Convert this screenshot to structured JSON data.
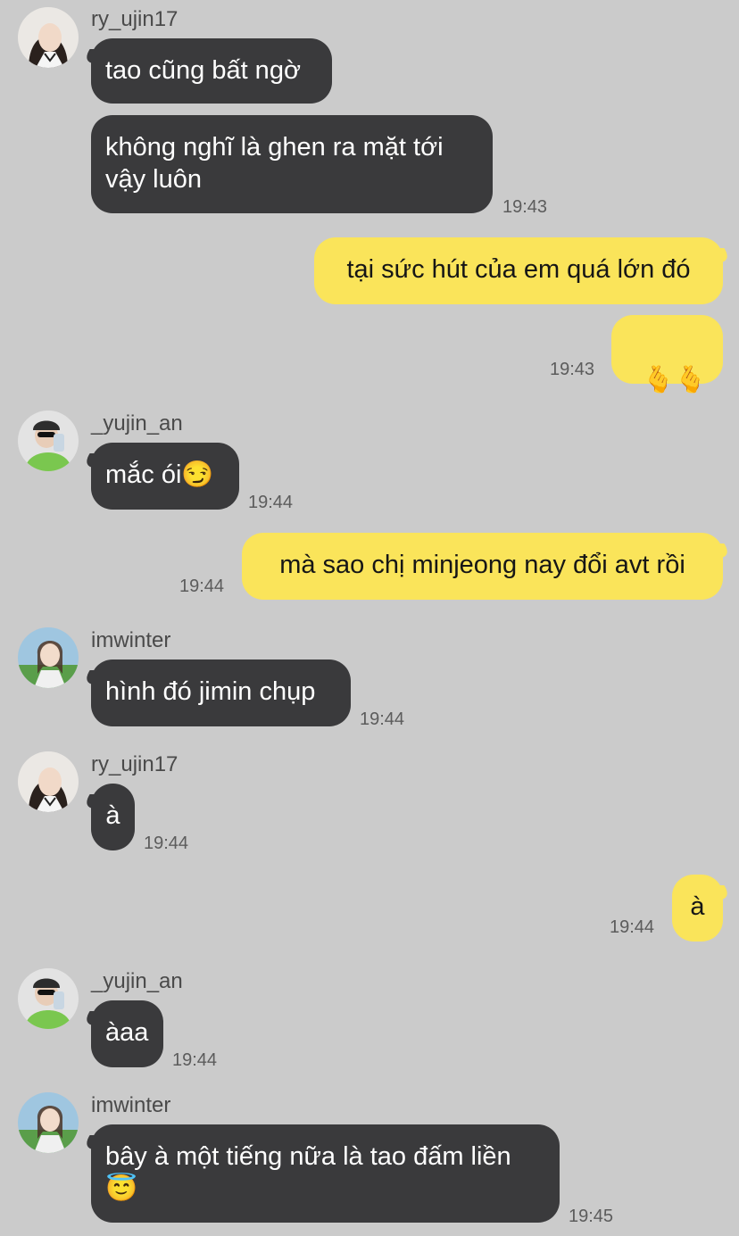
{
  "messages": [
    {
      "type": "in",
      "user": "ry_ujin17",
      "text": "tao cũng bất ngờ"
    },
    {
      "type": "in",
      "user": "ry_ujin17",
      "text": "không nghĩ là ghen ra mặt tới vậy luôn",
      "time": "19:43"
    },
    {
      "type": "out",
      "text": "tại sức hút của em quá lớn đó"
    },
    {
      "type": "out",
      "text": "🫰🫰",
      "time": "19:43"
    },
    {
      "type": "in",
      "user": "_yujin_an",
      "text": "mắc ói😏",
      "time": "19:44"
    },
    {
      "type": "out",
      "text": "mà sao chị minjeong nay đổi avt rồi",
      "time": "19:44"
    },
    {
      "type": "in",
      "user": "imwinter",
      "text": "hình đó jimin chụp",
      "time": "19:44"
    },
    {
      "type": "in",
      "user": "ry_ujin17",
      "text": "à",
      "time": "19:44"
    },
    {
      "type": "out",
      "text": "à",
      "time": "19:44"
    },
    {
      "type": "in",
      "user": "_yujin_an",
      "text": "àaa",
      "time": "19:44"
    },
    {
      "type": "in",
      "user": "imwinter",
      "text": "bây à một tiếng nữa là tao đấm liền\n😇",
      "time": "19:45"
    }
  ],
  "users": {
    "ry_ujin17": {
      "name": "ry_ujin17",
      "avatar_icon": "profile-photo-icon",
      "avatar_color": "#e9e6e2"
    },
    "_yujin_an": {
      "name": "_yujin_an",
      "avatar_icon": "profile-photo-icon",
      "avatar_color": "#7ac74f"
    },
    "imwinter": {
      "name": "imwinter",
      "avatar_icon": "profile-photo-icon",
      "avatar_color": "#9fc6e0"
    }
  },
  "colors": {
    "background": "#cbcbcb",
    "incoming_bubble": "#3a3a3c",
    "outgoing_bubble": "#fae45a",
    "timestamp": "#5c5c5c"
  }
}
